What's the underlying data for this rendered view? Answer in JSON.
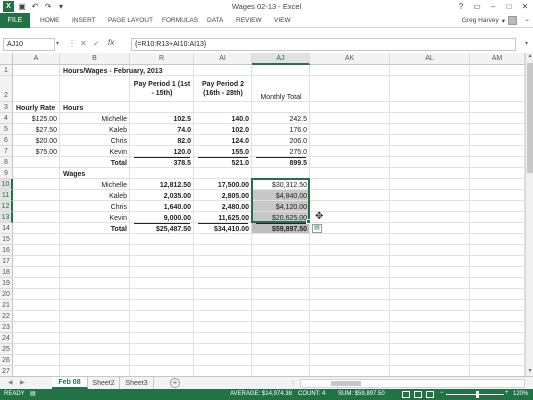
{
  "window": {
    "title": "Wages 02-13 - Excel",
    "logo": "X",
    "help": "?",
    "restore": "▭",
    "minimize": "–",
    "maximize": "□",
    "close": "✕"
  },
  "quick_access": {
    "save_icon": "save-icon",
    "undo_icon": "undo-icon",
    "redo_icon": "redo-icon"
  },
  "ribbon": {
    "file": "FILE",
    "tabs": [
      "HOME",
      "INSERT",
      "PAGE LAYOUT",
      "FORMULAS",
      "DATA",
      "REVIEW",
      "VIEW"
    ],
    "user": "Greg Harvey"
  },
  "formula_bar": {
    "name_box": "AJ10",
    "fx": "fx",
    "formula": "{=R10:R13+AI10:AI13}"
  },
  "columns": [
    "A",
    "B",
    "R",
    "AI",
    "AJ",
    "AK",
    "AL",
    "AM"
  ],
  "rows": [
    "1",
    "2",
    "3",
    "4",
    "5",
    "6",
    "7",
    "8",
    "9",
    "10",
    "11",
    "12",
    "13",
    "14",
    "15",
    "16",
    "17",
    "18",
    "19",
    "20",
    "21",
    "22",
    "23",
    "24",
    "25",
    "26",
    "27"
  ],
  "cells": {
    "title": "Hours/Wages - February, 2013",
    "pay_period_1": "Pay Period 1 (1st - 15th)",
    "pay_period_2": "Pay Period 2 (16th - 28th)",
    "monthly_total": "Monthly Total",
    "hourly_rate_hdr": "Hourly Rate",
    "hours_hdr": "Hours",
    "wages_hdr": "Wages",
    "rates": [
      "$125.00",
      "$27.50",
      "$20.00",
      "$75.00"
    ],
    "names": [
      "Michelle",
      "Kaleb",
      "Chris",
      "Kevin"
    ],
    "hours_p1": [
      "102.5",
      "74.0",
      "82.0",
      "120.0"
    ],
    "hours_p2": [
      "140.0",
      "102.0",
      "124.0",
      "155.0"
    ],
    "hours_total": [
      "242.5",
      "176.0",
      "206.0",
      "275.0"
    ],
    "total_label": "Total",
    "hours_sum": [
      "378.5",
      "521.0",
      "899.5"
    ],
    "wages_p1": [
      "12,812.50",
      "2,035.00",
      "1,640.00",
      "9,000.00"
    ],
    "wages_p2": [
      "17,500.00",
      "2,805.00",
      "2,480.00",
      "11,625.00"
    ],
    "wages_total": [
      "$30,312.50",
      "$4,840.00",
      "$4,120.00",
      "$20,625.00"
    ],
    "wages_sum": [
      "$25,487.50",
      "$34,410.00",
      "$59,897.50"
    ]
  },
  "sheets": [
    "Feb 08",
    "Sheet2",
    "Sheet3"
  ],
  "add_sheet": "+",
  "status": {
    "ready": "READY",
    "average": "AVERAGE: $14,974.38",
    "count": "COUNT: 4",
    "sum": "SUM: $59,897.50",
    "zoom_minus": "−",
    "zoom_plus": "+",
    "zoom": "120%"
  },
  "selected": {
    "column": "AJ",
    "rows": [
      "10",
      "11",
      "12",
      "13"
    ]
  }
}
